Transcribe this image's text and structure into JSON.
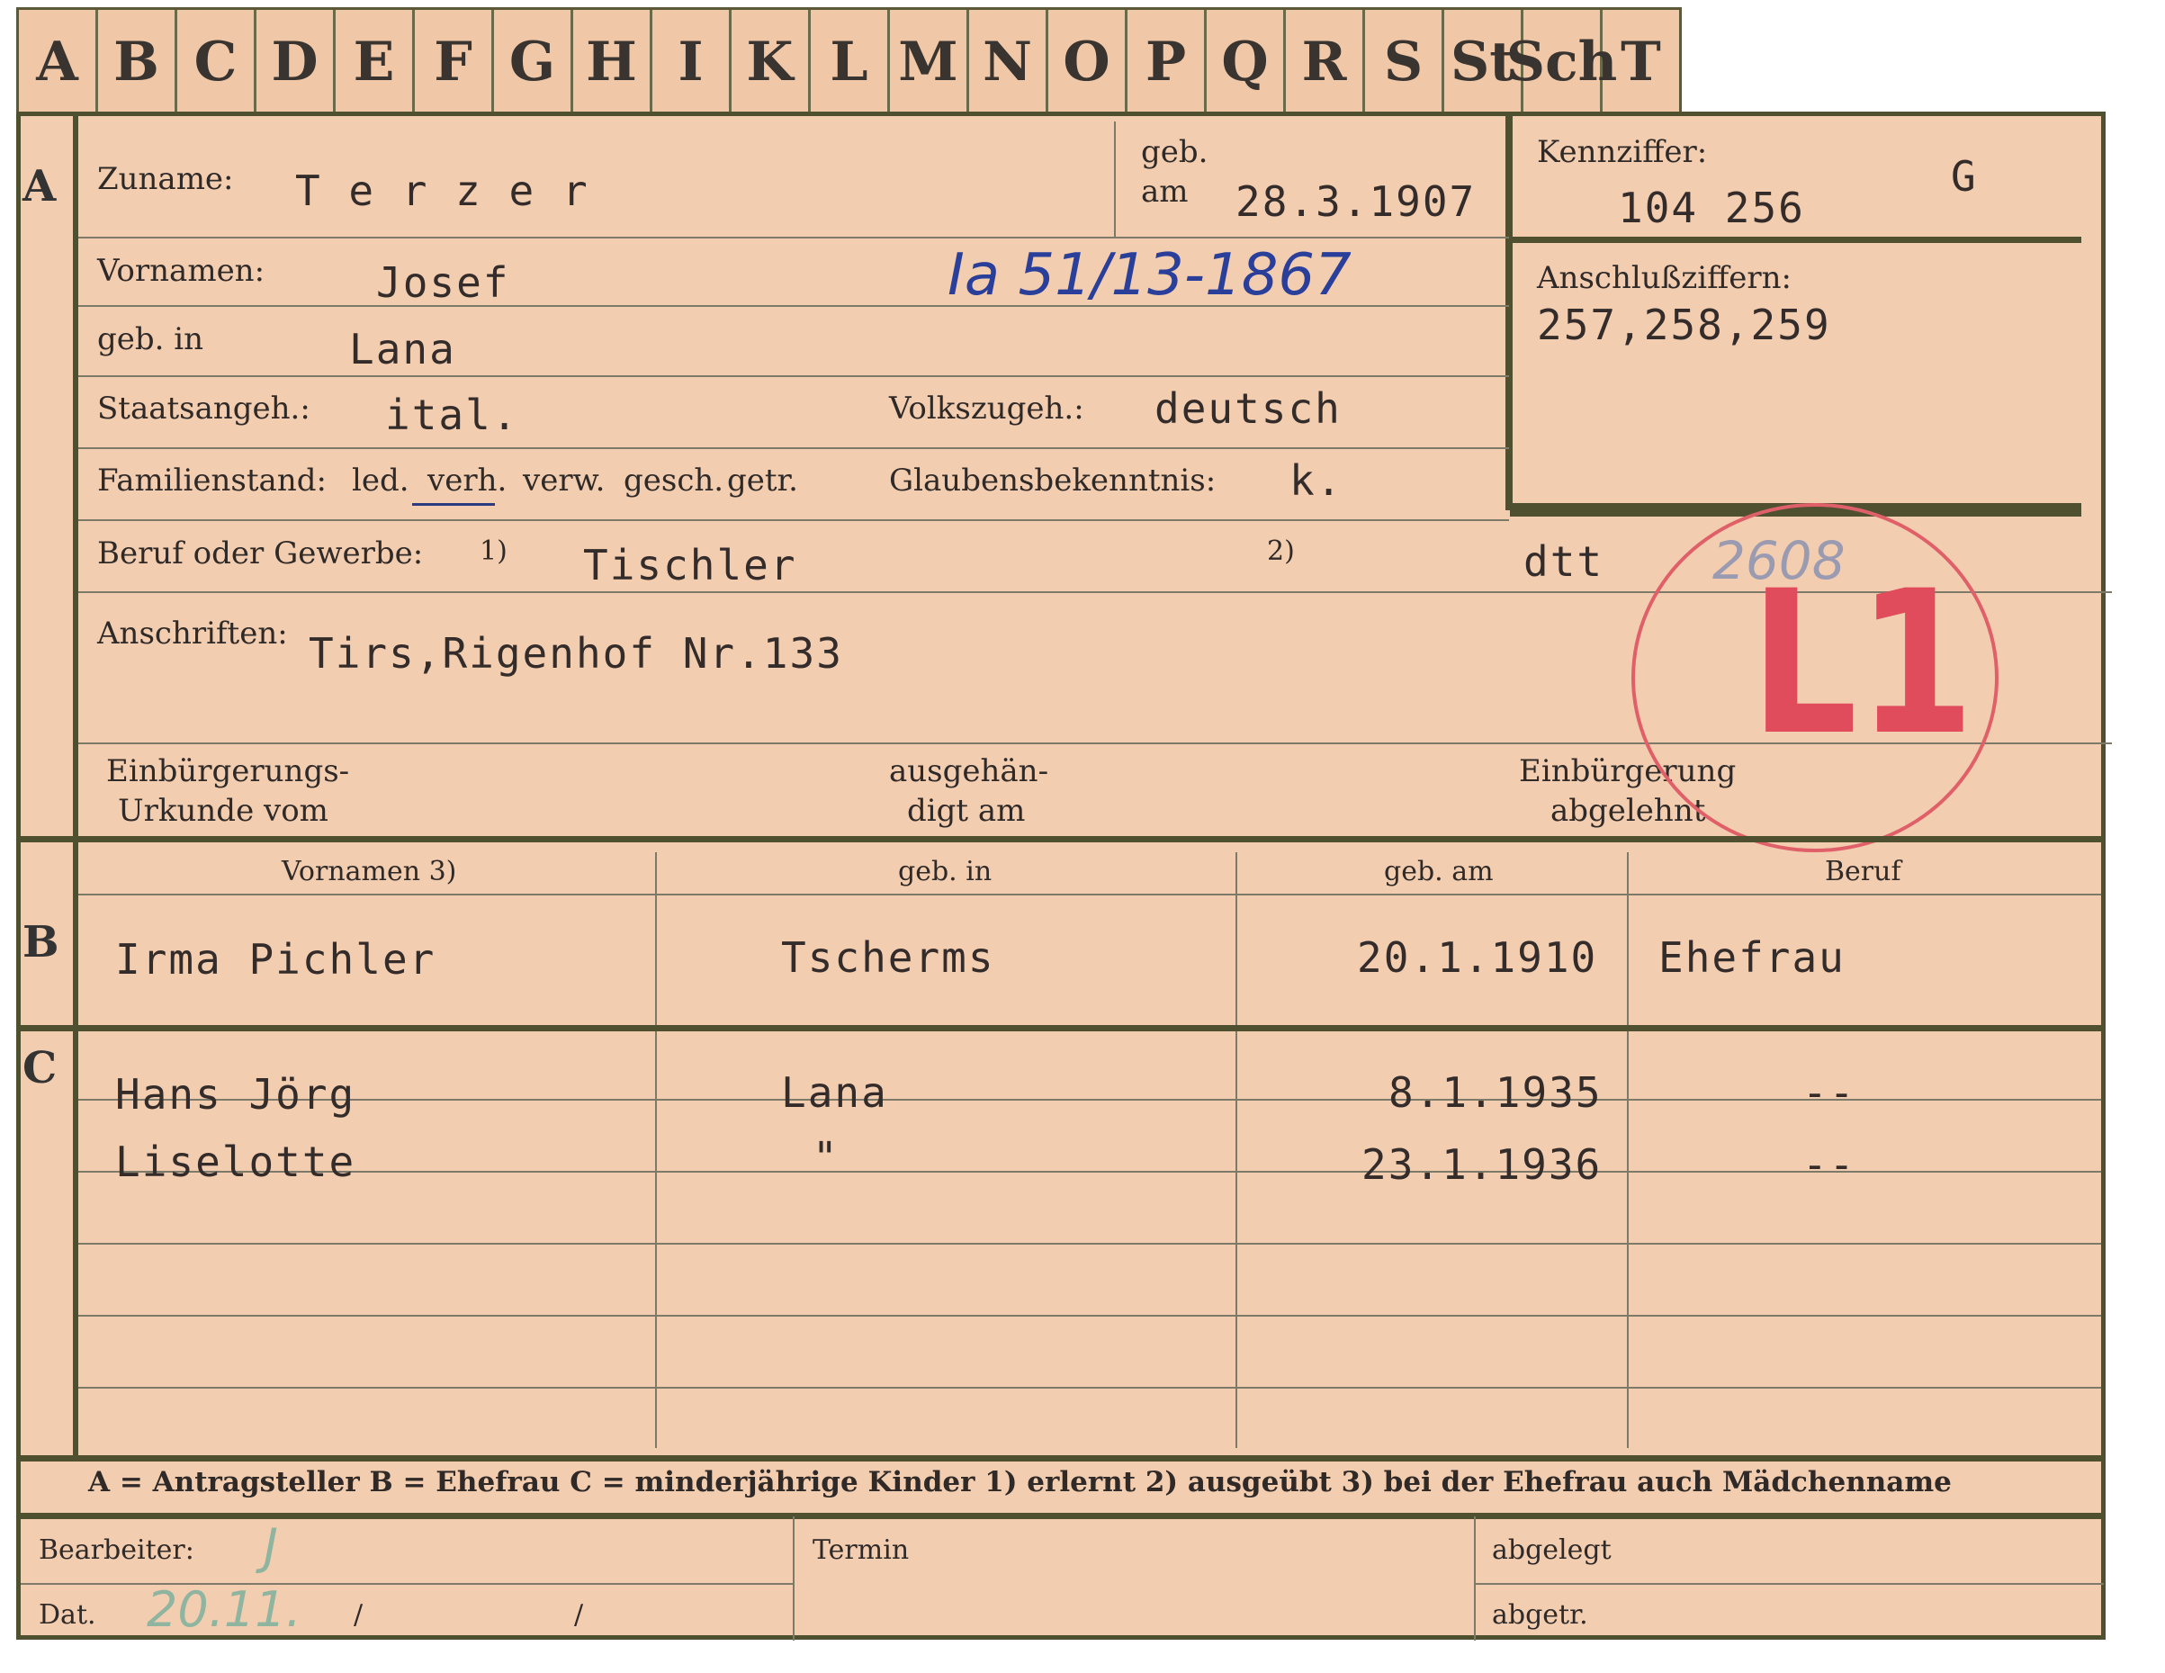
{
  "tabs": [
    "A",
    "B",
    "C",
    "D",
    "E",
    "F",
    "G",
    "H",
    "I",
    "K",
    "L",
    "M",
    "N",
    "O",
    "P",
    "Q",
    "R",
    "S",
    "St",
    "Sch",
    "T"
  ],
  "section_markers": {
    "a": "A",
    "b": "B",
    "c": "C"
  },
  "labels": {
    "zuname": "Zuname:",
    "geb": "geb.",
    "am": "am",
    "kennziffer": "Kennziffer:",
    "vornamen": "Vornamen:",
    "anschlussziffern": "Anschlußziffern:",
    "geb_in": "geb. in",
    "staatsangeh": "Staatsangeh.:",
    "volkszugeh": "Volkszugeh.:",
    "familienstand": "Familienstand:",
    "fam_options": [
      "led.",
      "verh.",
      "verw.",
      "gesch.",
      "getr."
    ],
    "glaubensbekenntnis": "Glaubensbekenntnis:",
    "beruf": "Beruf oder Gewerbe:",
    "fn1": "1)",
    "fn2": "2)",
    "anschriften": "Anschriften:",
    "einb_urkunde_1": "Einbürgerungs-",
    "einb_urkunde_2": "Urkunde vom",
    "ausgehaen_1": "ausgehän-",
    "ausgehaen_2": "digt am",
    "einb_abgelehnt_1": "Einbürgerung",
    "einb_abgelehnt_2": "abgelehnt",
    "col_vornamen": "Vornamen 3)",
    "col_geb_in": "geb. in",
    "col_geb_am": "geb. am",
    "col_beruf": "Beruf",
    "legend": "A = Antragsteller   B = Ehefrau   C = minderjährige Kinder   1) erlernt   2) ausgeübt   3) bei der Ehefrau auch Mädchenname",
    "bearbeiter": "Bearbeiter:",
    "termin": "Termin",
    "abgelegt": "abgelegt",
    "dat": "Dat.",
    "abgetr": "abgetr.",
    "slash1": "/",
    "slash2": "/"
  },
  "applicant": {
    "surname": "T e r z e r",
    "birth_date": "28.3.1907",
    "kennziffer": "104 256",
    "kennziffer_letter": "G",
    "first_names": "Josef",
    "file_ref": "Ia 51/13-1867",
    "anschlussziffern": "257,258,259",
    "birthplace": "Lana",
    "citizenship": "ital.",
    "ethnicity": "deutsch",
    "religion": "k.",
    "profession": "Tischler",
    "profession_note": "dtt",
    "address": "Tirs,Rigenhof Nr.133"
  },
  "stamp": {
    "number": "2608",
    "code": "L1"
  },
  "wife": {
    "name": "Irma Pichler",
    "birthplace": "Tscherms",
    "birth_date": "20.1.1910",
    "profession": "Ehefrau"
  },
  "children": [
    {
      "name": "Hans Jörg",
      "birthplace": "Lana",
      "birth_date": "8.1.1935",
      "profession": "--"
    },
    {
      "name": "Liselotte",
      "birthplace": "\"",
      "birth_date": "23.1.1936",
      "profession": "--"
    }
  ],
  "footer_handwriting": {
    "bearbeiter_mark": "J",
    "date_mark": "20.11."
  }
}
